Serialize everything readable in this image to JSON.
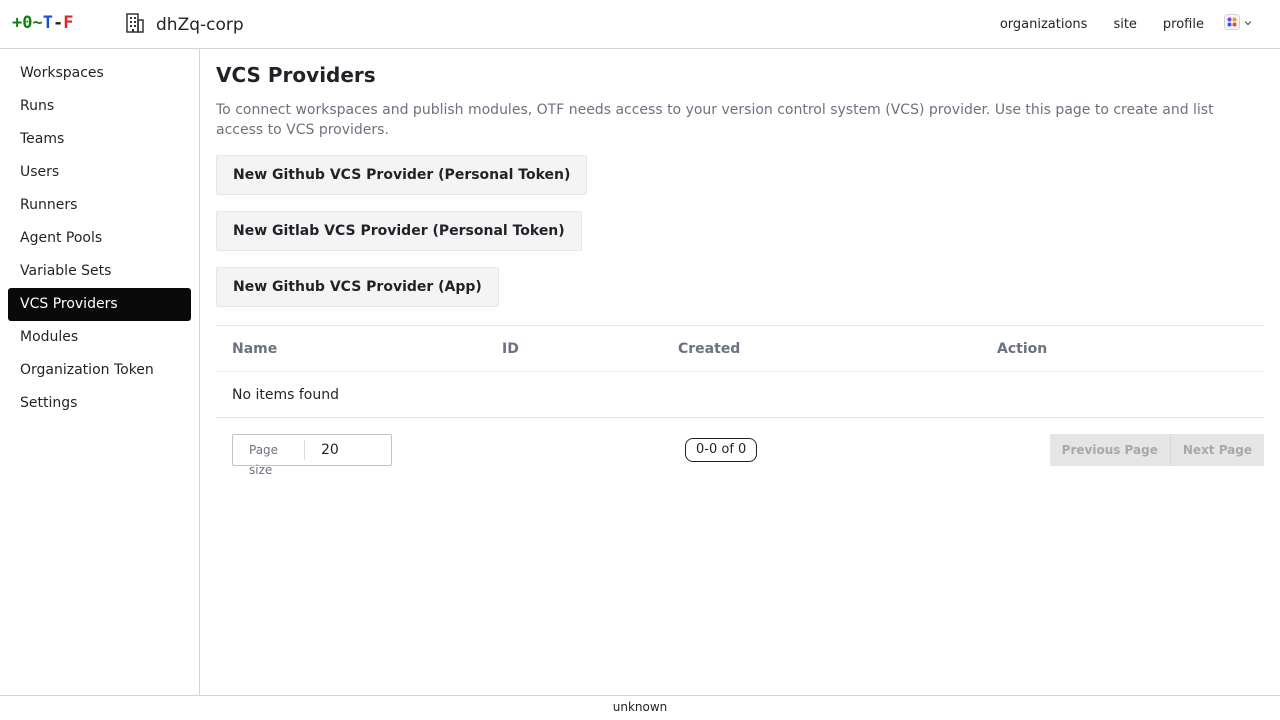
{
  "header": {
    "logo": {
      "parts": [
        "+0",
        "~",
        "T",
        "-",
        "F"
      ],
      "colors": [
        "#108010",
        "#108010",
        "#1d4ed8",
        "#1f2328",
        "#dc2626"
      ]
    },
    "org_icon": "building-icon",
    "org_name": "dhZq-corp",
    "nav": [
      "organizations",
      "site",
      "profile"
    ],
    "theme_icon": "palette-icon"
  },
  "sidebar": {
    "items": [
      {
        "label": "Workspaces"
      },
      {
        "label": "Runs"
      },
      {
        "label": "Teams"
      },
      {
        "label": "Users"
      },
      {
        "label": "Runners"
      },
      {
        "label": "Agent Pools"
      },
      {
        "label": "Variable Sets"
      },
      {
        "label": "VCS Providers",
        "active": true
      },
      {
        "label": "Modules"
      },
      {
        "label": "Organization Token"
      },
      {
        "label": "Settings"
      }
    ]
  },
  "main": {
    "title": "VCS Providers",
    "description": "To connect workspaces and publish modules, OTF needs access to your version control system (VCS) provider. Use this page to create and list access to VCS providers.",
    "buttons": [
      "New Github VCS Provider (Personal Token)",
      "New Gitlab VCS Provider (Personal Token)",
      "New Github VCS Provider (App)"
    ],
    "table": {
      "columns": [
        "Name",
        "ID",
        "Created",
        "Action"
      ],
      "empty_text": "No items found"
    },
    "pager": {
      "page_size_label": "Page size",
      "page_size": "20",
      "count": "0-0 of 0",
      "previous": "Previous Page",
      "next": "Next Page"
    }
  },
  "footer": {
    "text": "unknown"
  }
}
